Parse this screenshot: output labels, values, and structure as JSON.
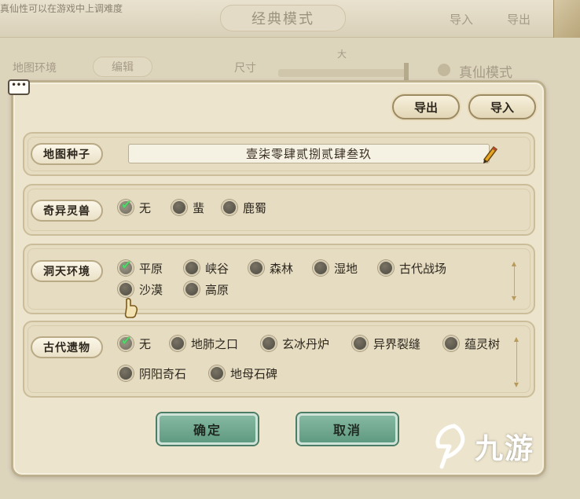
{
  "background": {
    "hint_text": "真仙性可以在游戏中上调难度",
    "title": "经典模式",
    "import_label": "导入",
    "export_label": "导出",
    "map_env_label": "地图环境",
    "edit_label": "编辑",
    "size_label": "尺寸",
    "size_value": "大",
    "mode_label": "真仙模式"
  },
  "chat_bubble": "•••",
  "header": {
    "export_label": "导出",
    "import_label": "导入"
  },
  "seed": {
    "label": "地图种子",
    "value": "壹柒零肆贰捌贰肆叁玖"
  },
  "beast": {
    "label": "奇异灵兽",
    "options": [
      "无",
      "蜚",
      "鹿蜀"
    ]
  },
  "terrain": {
    "label": "洞天环境",
    "options": [
      "平原",
      "峡谷",
      "森林",
      "湿地",
      "古代战场",
      "沙漠",
      "高原"
    ]
  },
  "relic": {
    "label": "古代遗物",
    "options": [
      "无",
      "地肺之口",
      "玄冰丹炉",
      "异界裂缝",
      "蕴灵树",
      "阴阳奇石",
      "地母石碑"
    ]
  },
  "actions": {
    "confirm_label": "确定",
    "cancel_label": "取消"
  },
  "watermark": {
    "text": "九游"
  },
  "colors": {
    "panel_bg": "#ece4cd",
    "button_green": "#6fa88d",
    "check_green": "#4fd96a"
  }
}
